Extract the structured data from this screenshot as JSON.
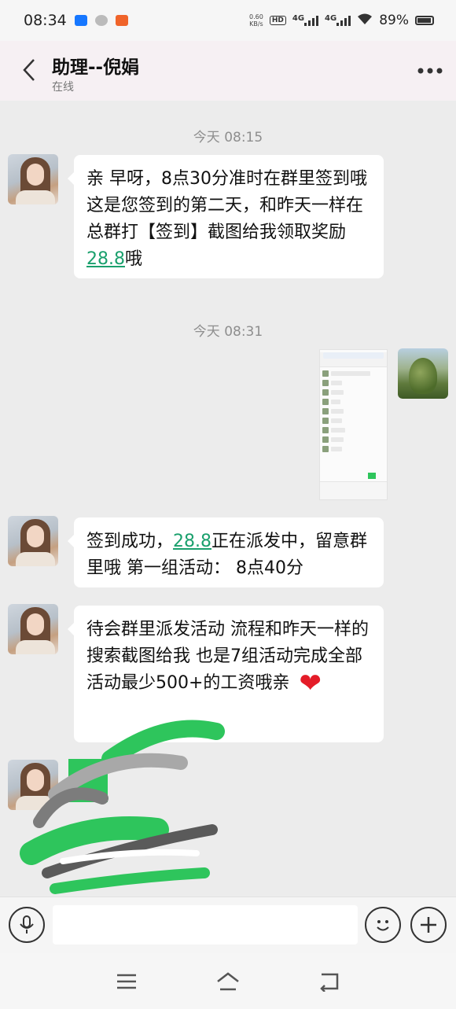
{
  "status_bar": {
    "time": "08:34",
    "net_speed_top": "0.60",
    "net_speed_unit": "KB/s",
    "hd_label": "HD",
    "signal1": "4G",
    "signal2": "4G",
    "battery": "89%",
    "notification_icons": [
      "alipay-icon",
      "wechat-icon",
      "app-badge-icon"
    ]
  },
  "header": {
    "title": "助理--倪娟",
    "status": "在线",
    "back_icon": "chevron-left-icon",
    "more_icon": "more-dots-icon"
  },
  "messages": [
    {
      "type": "timestamp",
      "text": "今天 08:15"
    },
    {
      "type": "incoming",
      "parts": [
        "亲 早呀，8点30分准时在群里签到哦 这是您签到的第二天，和昨天一样在总群打【签到】截图给我领取奖励",
        "28.8",
        "哦"
      ]
    },
    {
      "type": "timestamp",
      "text": "今天 08:31"
    },
    {
      "type": "outgoing-image",
      "description": "screenshot"
    },
    {
      "type": "incoming",
      "parts": [
        "签到成功，",
        "28.8",
        "正在派发中，留意群里哦 第一组活动： 8点40分"
      ]
    },
    {
      "type": "incoming",
      "parts": [
        "待会群里派发活动 流程和昨天一样的搜索截图给我  也是7组活动完成全部活动最少500+的工资哦亲"
      ],
      "emoji": "❤"
    }
  ],
  "input_bar": {
    "placeholder": "",
    "voice_icon": "microphone-icon",
    "emoji_icon": "smiley-icon",
    "plus_icon": "plus-icon"
  },
  "nav_bar": {
    "icons": [
      "menu-icon",
      "home-icon",
      "back-icon"
    ]
  },
  "colors": {
    "link": "#1aa06d",
    "header_bg": "#f6f0f3",
    "chat_bg": "#ececec",
    "scribble_green": "#2ec55c"
  }
}
